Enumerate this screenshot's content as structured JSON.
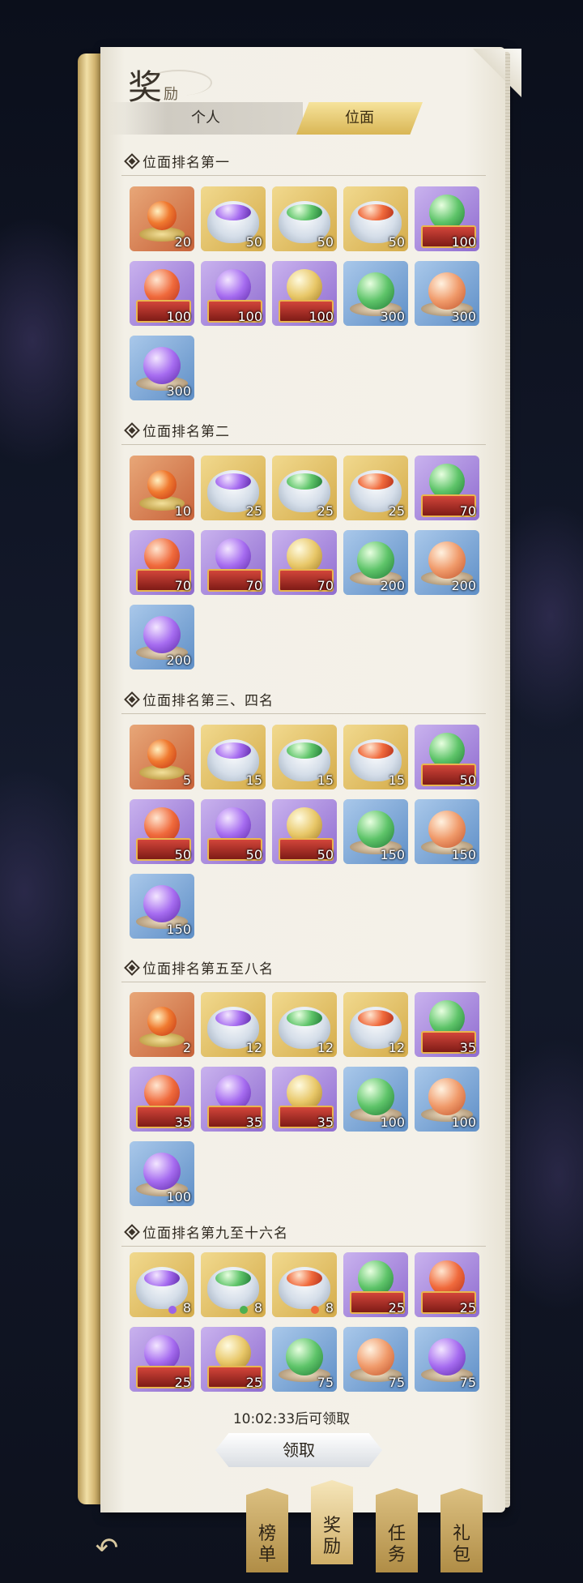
{
  "header": {
    "title_big": "奖",
    "title_small": "励"
  },
  "tabs": [
    {
      "label": "个人"
    },
    {
      "label": "位面"
    }
  ],
  "selected_tab": "位面",
  "sections": [
    {
      "title": "位面排名第一",
      "items": [
        {
          "kind": "lotus",
          "bg": "orange",
          "count": "20"
        },
        {
          "kind": "pot",
          "bg": "gold",
          "orb": "purple",
          "count": "50"
        },
        {
          "kind": "pot",
          "bg": "gold",
          "orb": "green",
          "count": "50"
        },
        {
          "kind": "pot",
          "bg": "gold",
          "orb": "red",
          "count": "50"
        },
        {
          "kind": "box",
          "bg": "purple",
          "orb": "green",
          "count": "100"
        },
        {
          "kind": "box",
          "bg": "purple",
          "orb": "red",
          "count": "100"
        },
        {
          "kind": "box",
          "bg": "purple",
          "orb": "purple",
          "count": "100"
        },
        {
          "kind": "box",
          "bg": "purple",
          "orb": "yellow",
          "count": "100"
        },
        {
          "kind": "dish",
          "bg": "blue",
          "orb": "green",
          "count": "300"
        },
        {
          "kind": "dish",
          "bg": "blue",
          "orb": "peach",
          "count": "300"
        },
        {
          "kind": "dish",
          "bg": "blue",
          "orb": "purple",
          "count": "300"
        }
      ]
    },
    {
      "title": "位面排名第二",
      "items": [
        {
          "kind": "lotus",
          "bg": "orange",
          "count": "10"
        },
        {
          "kind": "pot",
          "bg": "gold",
          "orb": "purple",
          "count": "25"
        },
        {
          "kind": "pot",
          "bg": "gold",
          "orb": "green",
          "count": "25"
        },
        {
          "kind": "pot",
          "bg": "gold",
          "orb": "red",
          "count": "25"
        },
        {
          "kind": "box",
          "bg": "purple",
          "orb": "green",
          "count": "70"
        },
        {
          "kind": "box",
          "bg": "purple",
          "orb": "red",
          "count": "70"
        },
        {
          "kind": "box",
          "bg": "purple",
          "orb": "purple",
          "count": "70"
        },
        {
          "kind": "box",
          "bg": "purple",
          "orb": "yellow",
          "count": "70"
        },
        {
          "kind": "dish",
          "bg": "blue",
          "orb": "green",
          "count": "200"
        },
        {
          "kind": "dish",
          "bg": "blue",
          "orb": "peach",
          "count": "200"
        },
        {
          "kind": "dish",
          "bg": "blue",
          "orb": "purple",
          "count": "200"
        }
      ]
    },
    {
      "title": "位面排名第三、四名",
      "items": [
        {
          "kind": "lotus",
          "bg": "orange",
          "count": "5"
        },
        {
          "kind": "pot",
          "bg": "gold",
          "orb": "purple",
          "count": "15"
        },
        {
          "kind": "pot",
          "bg": "gold",
          "orb": "green",
          "count": "15"
        },
        {
          "kind": "pot",
          "bg": "gold",
          "orb": "red",
          "count": "15"
        },
        {
          "kind": "box",
          "bg": "purple",
          "orb": "green",
          "count": "50"
        },
        {
          "kind": "box",
          "bg": "purple",
          "orb": "red",
          "count": "50"
        },
        {
          "kind": "box",
          "bg": "purple",
          "orb": "purple",
          "count": "50"
        },
        {
          "kind": "box",
          "bg": "purple",
          "orb": "yellow",
          "count": "50"
        },
        {
          "kind": "dish",
          "bg": "blue",
          "orb": "green",
          "count": "150"
        },
        {
          "kind": "dish",
          "bg": "blue",
          "orb": "peach",
          "count": "150"
        },
        {
          "kind": "dish",
          "bg": "blue",
          "orb": "purple",
          "count": "150"
        }
      ]
    },
    {
      "title": "位面排名第五至八名",
      "items": [
        {
          "kind": "lotus",
          "bg": "orange",
          "count": "2"
        },
        {
          "kind": "pot",
          "bg": "gold",
          "orb": "purple",
          "count": "12"
        },
        {
          "kind": "pot",
          "bg": "gold",
          "orb": "green",
          "count": "12"
        },
        {
          "kind": "pot",
          "bg": "gold",
          "orb": "red",
          "count": "12"
        },
        {
          "kind": "box",
          "bg": "purple",
          "orb": "green",
          "count": "35"
        },
        {
          "kind": "box",
          "bg": "purple",
          "orb": "red",
          "count": "35"
        },
        {
          "kind": "box",
          "bg": "purple",
          "orb": "purple",
          "count": "35"
        },
        {
          "kind": "box",
          "bg": "purple",
          "orb": "yellow",
          "count": "35"
        },
        {
          "kind": "dish",
          "bg": "blue",
          "orb": "green",
          "count": "100"
        },
        {
          "kind": "dish",
          "bg": "blue",
          "orb": "peach",
          "count": "100"
        },
        {
          "kind": "dish",
          "bg": "blue",
          "orb": "purple",
          "count": "100"
        }
      ]
    },
    {
      "title": "位面排名第九至十六名",
      "items": [
        {
          "kind": "pot",
          "bg": "gold",
          "orb": "purple",
          "mini": "purple",
          "count": "8"
        },
        {
          "kind": "pot",
          "bg": "gold",
          "orb": "green",
          "mini": "green",
          "count": "8"
        },
        {
          "kind": "pot",
          "bg": "gold",
          "orb": "red",
          "mini": "red",
          "count": "8"
        },
        {
          "kind": "box",
          "bg": "purple",
          "orb": "green",
          "count": "25"
        },
        {
          "kind": "box",
          "bg": "purple",
          "orb": "red",
          "count": "25"
        },
        {
          "kind": "box",
          "bg": "purple",
          "orb": "purple",
          "count": "25"
        },
        {
          "kind": "box",
          "bg": "purple",
          "orb": "yellow",
          "count": "25"
        },
        {
          "kind": "dish",
          "bg": "blue",
          "orb": "green",
          "count": "75"
        },
        {
          "kind": "dish",
          "bg": "blue",
          "orb": "peach",
          "count": "75"
        },
        {
          "kind": "dish",
          "bg": "blue",
          "orb": "purple",
          "count": "75"
        }
      ]
    }
  ],
  "footer": {
    "timer_text": "10:02:33后可领取",
    "claim_label": "领取"
  },
  "bottom_tabs": [
    {
      "label_1": "榜",
      "label_2": "单"
    },
    {
      "label_1": "奖",
      "label_2": "励"
    },
    {
      "label_1": "任",
      "label_2": "务"
    },
    {
      "label_1": "礼",
      "label_2": "包"
    }
  ],
  "active_bottom_tab": "奖励",
  "icons": {
    "back": "back-arrow-icon",
    "section": "diamond-bullet-icon"
  }
}
